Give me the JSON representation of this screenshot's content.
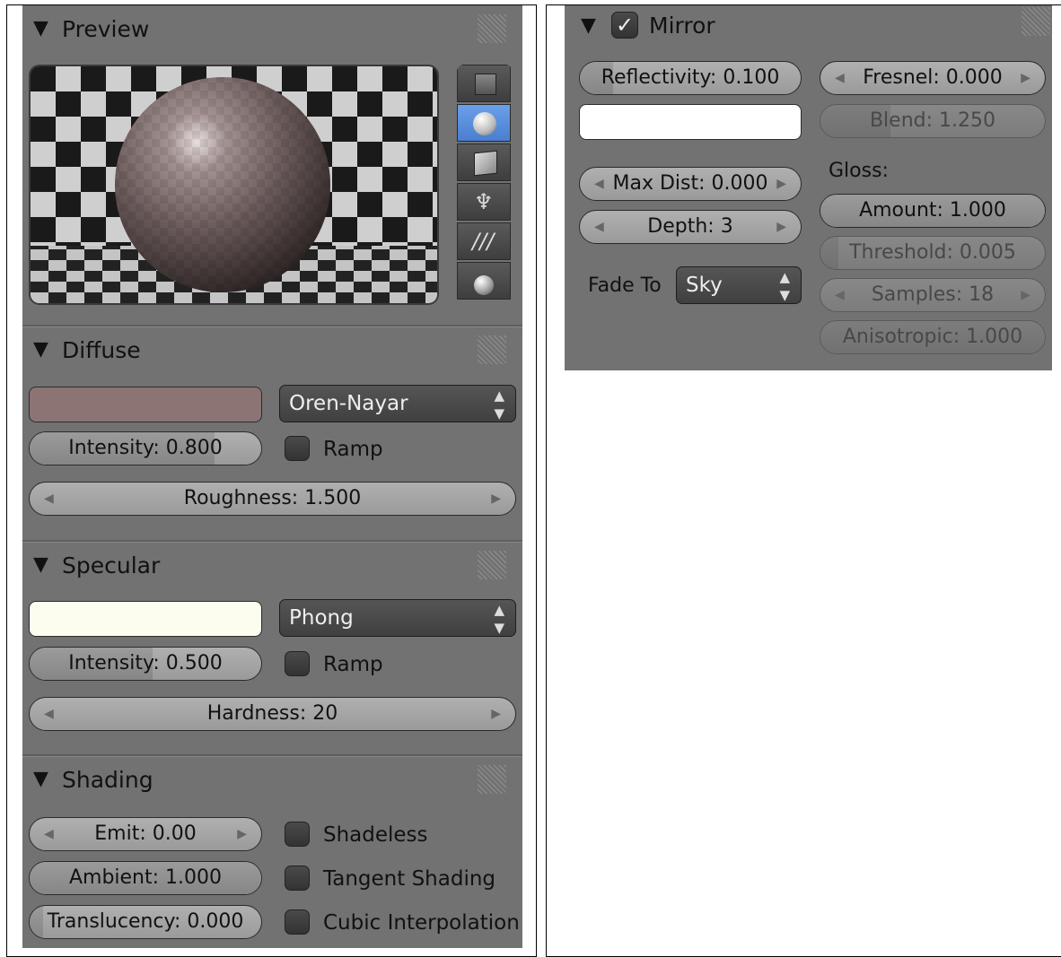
{
  "left_panel": {
    "preview": {
      "title": "Preview"
    },
    "preview_tools": [
      {
        "icon": "flat-square-icon",
        "selected": false
      },
      {
        "icon": "sphere-icon",
        "selected": true
      },
      {
        "icon": "cube-icon",
        "selected": false
      },
      {
        "icon": "monkey-icon",
        "selected": false
      },
      {
        "icon": "hair-strands-icon",
        "selected": false
      },
      {
        "icon": "sphere-plane-icon",
        "selected": false
      }
    ],
    "diffuse": {
      "title": "Diffuse",
      "color": "#8c7474",
      "shader": "Oren-Nayar",
      "intensity": "Intensity: 0.800",
      "intensity_value": 0.8,
      "ramp": "Ramp",
      "roughness": "Roughness: 1.500"
    },
    "specular": {
      "title": "Specular",
      "color": "#fcfcef",
      "shader": "Phong",
      "intensity": "Intensity: 0.500",
      "intensity_value": 0.5,
      "ramp": "Ramp",
      "hardness": "Hardness: 20"
    },
    "shading": {
      "title": "Shading",
      "emit": "Emit: 0.00",
      "ambient": "Ambient: 1.000",
      "translucency": "Translucency: 0.000",
      "shadeless": "Shadeless",
      "tangent": "Tangent Shading",
      "cubic": "Cubic Interpolation"
    }
  },
  "mirror_panel": {
    "title": "Mirror",
    "enabled": true,
    "reflectivity": "Reflectivity: 0.100",
    "reflectivity_value": 0.1,
    "color": "#ffffff",
    "fresnel": "Fresnel: 0.000",
    "blend": "Blend: 1.250",
    "max_dist": "Max Dist: 0.000",
    "depth": "Depth: 3",
    "fade_to_label": "Fade To",
    "fade_to": "Sky",
    "gloss_label": "Gloss:",
    "amount": "Amount: 1.000",
    "threshold": "Threshold: 0.005",
    "samples": "Samples: 18",
    "anisotropic": "Anisotropic: 1.000"
  }
}
